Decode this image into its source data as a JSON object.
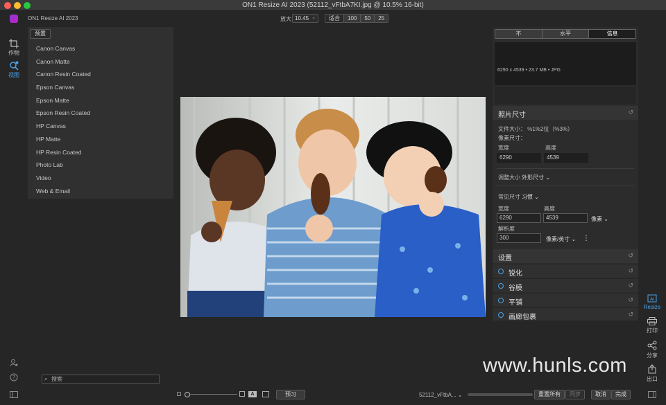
{
  "window": {
    "title": "ON1 Resize AI 2023 (52112_vFtbA7KI.jpg @ 10.5% 16-bit)"
  },
  "app": {
    "name": "ON1 Resize AI 2023"
  },
  "toolbar": {
    "zoom_label": "放大",
    "zoom_value": "10.45",
    "zoom_options": [
      "适合",
      "100",
      "50",
      "25"
    ]
  },
  "left_rail": {
    "crop_label": "作物",
    "view_label": "视图"
  },
  "presets": {
    "tab_label": "预置",
    "items": [
      "Canon Canvas",
      "Canon Matte",
      "Canon Resin Coated",
      "Epson Canvas",
      "Epson Matte",
      "Epson Resin Coated",
      "HP Canvas",
      "HP Matte",
      "HP Resin Coated",
      "Photo Lab",
      "Video",
      "Web & Email"
    ]
  },
  "search": {
    "placeholder": "搜索"
  },
  "info_panel": {
    "tabs": [
      "不",
      "水平",
      "信息"
    ],
    "file_info": "6290 x 4539 • 23.7 MB • JPG"
  },
  "photo_size": {
    "title": "照片尺寸",
    "file_size": "文件大小： %1%2位（%3%）",
    "pixel_size_label": "像素尺寸：",
    "width_label": "宽度",
    "height_label": "高度",
    "width_value": "6290",
    "height_value": "4539",
    "adjust_label": "调整大小",
    "adjust_value": "外形尺寸",
    "common_size_label": "常见尺寸",
    "common_size_value": "习惯",
    "width2_label": "宽度",
    "height2_label": "高度",
    "width2_value": "6290",
    "height2_value": "4539",
    "unit_value": "像素",
    "resolution_label": "解析度",
    "resolution_value": "300",
    "resolution_unit": "像素/英寸",
    "more": "⋮"
  },
  "settings": {
    "title": "设置",
    "options": [
      "锐化",
      "谷膜",
      "平铺",
      "画廊包裹"
    ]
  },
  "right_rail": {
    "resize": "Resize",
    "print": "打印",
    "share": "分享",
    "export": "出口"
  },
  "bottom_bar": {
    "preview_button": "预习",
    "file_name": "52112_vFtbA...",
    "reset_all": "重置所有",
    "sync": "同步",
    "cancel": "取消",
    "done": "完成"
  },
  "watermark": "www.hunls.com",
  "colors": {
    "accent": "#4aa3e8",
    "panel": "#303030",
    "background": "#262626"
  },
  "icons": {
    "crop": "crop-icon",
    "view": "view-icon",
    "user": "user-icon",
    "help": "help-icon",
    "print": "printer-icon",
    "share": "share-icon",
    "export": "export-icon"
  }
}
